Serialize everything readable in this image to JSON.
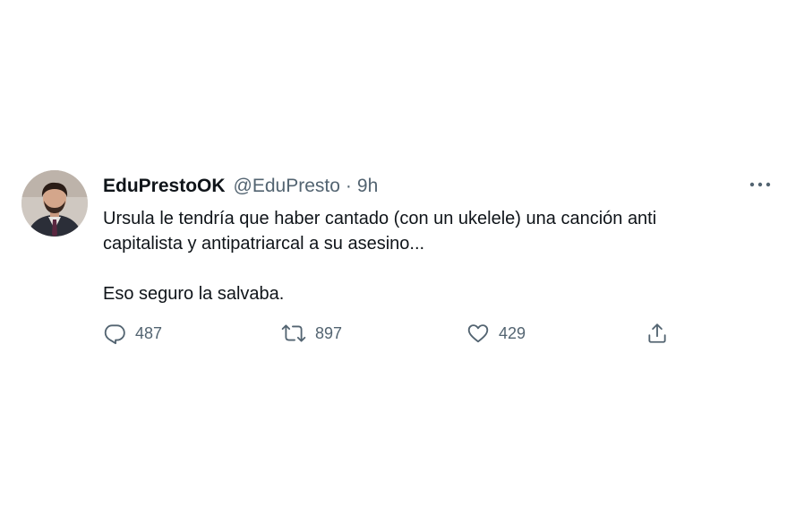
{
  "tweet": {
    "display_name": "EduPrestoOK",
    "handle": "@EduPresto",
    "separator": "·",
    "time": "9h",
    "text_line1": "Ursula le tendría que haber cantado (con un ukelele) una canción anti",
    "text_line2": "capitalista y antipatriarcal a su asesino...",
    "text_line3": "Eso seguro la salvaba.",
    "avatar_icon": "user-avatar-photo",
    "more_icon": "more-options-icon"
  },
  "actions": {
    "reply": {
      "icon": "reply-icon",
      "count": "487"
    },
    "retweet": {
      "icon": "retweet-icon",
      "count": "897"
    },
    "like": {
      "icon": "heart-icon",
      "count": "429"
    },
    "share": {
      "icon": "share-icon"
    }
  },
  "colors": {
    "text_primary": "#0f1419",
    "text_secondary": "#536471",
    "background": "#ffffff"
  }
}
